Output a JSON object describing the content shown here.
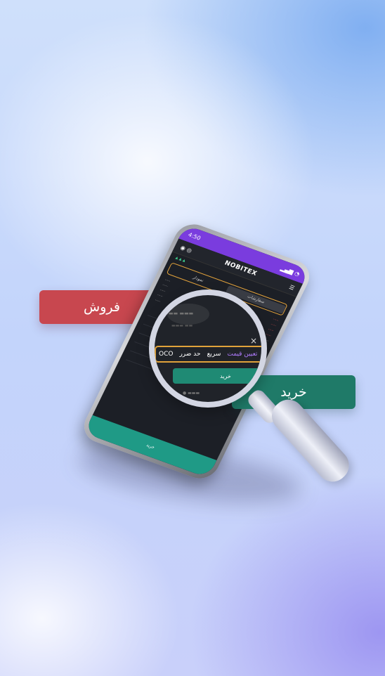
{
  "labels": {
    "sell": "فروش",
    "buy": "خرید"
  },
  "phone": {
    "time": "4:50",
    "brand": "NOBITEX",
    "top_tab_left": "سفارشات",
    "top_tab_right": "نمودار",
    "bottom_bar": "خرید"
  },
  "lens": {
    "tabs": [
      "OCO",
      "حد ضرر",
      "سریع",
      "تعیین قیمت"
    ],
    "close_symbol": "×",
    "buy_button": "خرید"
  },
  "colors": {
    "sell": "#c8474f",
    "buy": "#1f7a68",
    "accent_purple": "#7a3cde",
    "highlight_orange": "#e0a23a"
  }
}
